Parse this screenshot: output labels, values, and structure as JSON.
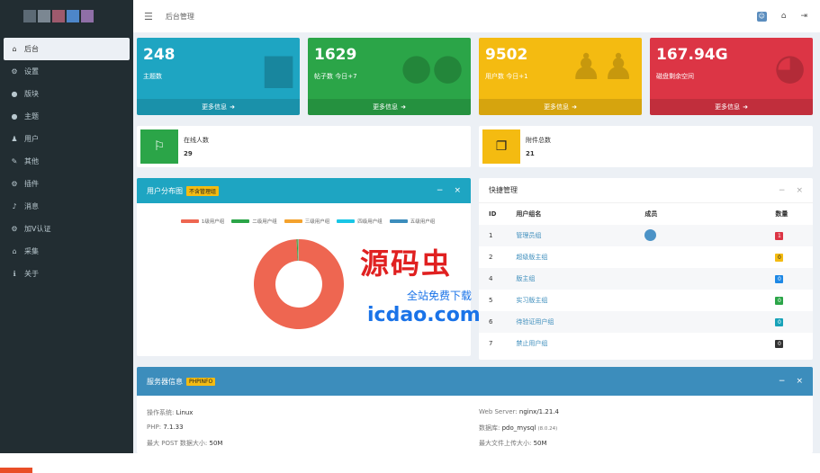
{
  "header": {
    "breadcrumb": "后台管理"
  },
  "sidebar": {
    "items": [
      {
        "label": "后台",
        "icon": "home-icon",
        "glyph": "⌂"
      },
      {
        "label": "设置",
        "icon": "gear-icon",
        "glyph": "⚙"
      },
      {
        "label": "版块",
        "icon": "comment-icon",
        "glyph": "●"
      },
      {
        "label": "主题",
        "icon": "comment-icon",
        "glyph": "●"
      },
      {
        "label": "用户",
        "icon": "user-icon",
        "glyph": "♟"
      },
      {
        "label": "其他",
        "icon": "wrench-icon",
        "glyph": "✎"
      },
      {
        "label": "插件",
        "icon": "gears-icon",
        "glyph": "⚙"
      },
      {
        "label": "消息",
        "icon": "bell-icon",
        "glyph": "♪"
      },
      {
        "label": "加V认证",
        "icon": "gears-icon",
        "glyph": "⚙"
      },
      {
        "label": "采集",
        "icon": "bank-icon",
        "glyph": "⌂"
      },
      {
        "label": "关于",
        "icon": "info-icon",
        "glyph": "ℹ"
      }
    ]
  },
  "stats": [
    {
      "value": "248",
      "label": "主题数",
      "more": "更多信息",
      "color": "#1ea5c2"
    },
    {
      "value": "1629",
      "label": "帖子数 今日+7",
      "more": "更多信息",
      "color": "#2ba548"
    },
    {
      "value": "9502",
      "label": "用户数 今日+1",
      "more": "更多信息",
      "color": "#f4bb11"
    },
    {
      "value": "167.94G",
      "label": "磁盘剩余空间",
      "more": "更多信息",
      "color": "#dc3545"
    }
  ],
  "info": [
    {
      "label": "在线人数",
      "value": "29"
    },
    {
      "label": "附件总数",
      "value": "21"
    }
  ],
  "user_panel": {
    "title": "用户分布图",
    "tag": "不含管理组",
    "legend": [
      {
        "name": "1级用户组",
        "color": "#ee6651"
      },
      {
        "name": "二级用户组",
        "color": "#2ba548"
      },
      {
        "name": "三级用户组",
        "color": "#f4a22d"
      },
      {
        "name": "四级用户组",
        "color": "#19c6e6"
      },
      {
        "name": "五级用户组",
        "color": "#3c8dbc"
      }
    ]
  },
  "chart_data": {
    "type": "pie",
    "categories": [
      "1级用户组",
      "二级用户组",
      "三级用户组",
      "四级用户组",
      "五级用户组"
    ],
    "values": [
      99.2,
      0.4,
      0.2,
      0.1,
      0.1
    ]
  },
  "quick_panel": {
    "title": "快捷管理",
    "columns": [
      "ID",
      "用户组名",
      "成员",
      "数量"
    ],
    "rows": [
      {
        "id": "1",
        "name": "管理员组",
        "count": "1",
        "badge": "b-red",
        "avatar": true
      },
      {
        "id": "2",
        "name": "超级版主组",
        "count": "0",
        "badge": "b-yellow",
        "avatar": false
      },
      {
        "id": "4",
        "name": "版主组",
        "count": "0",
        "badge": "b-blue",
        "avatar": false
      },
      {
        "id": "5",
        "name": "实习版主组",
        "count": "0",
        "badge": "b-green",
        "avatar": false
      },
      {
        "id": "6",
        "name": "待验证用户组",
        "count": "0",
        "badge": "b-teal",
        "avatar": false
      },
      {
        "id": "7",
        "name": "禁止用户组",
        "count": "0",
        "badge": "b-dark",
        "avatar": false
      }
    ]
  },
  "server_panel": {
    "title": "服务器信息",
    "tag": "PHPINFO",
    "left": [
      {
        "label": "操作系统:",
        "value": "Linux"
      },
      {
        "label": "PHP:",
        "value": "7.1.33"
      },
      {
        "label": "最大 POST 数据大小:",
        "value": "50M"
      }
    ],
    "right": [
      {
        "label": "Web Server:",
        "value": "nginx/1.21.4"
      },
      {
        "label": "数据库:",
        "value": "pdo_mysql",
        "extra": "(8.0.24)"
      },
      {
        "label": "最大文件上传大小:",
        "value": "50M"
      }
    ]
  },
  "watermark": {
    "brand": "源码虫",
    "sub": "全站免费下载",
    "url": "icdao.com"
  }
}
